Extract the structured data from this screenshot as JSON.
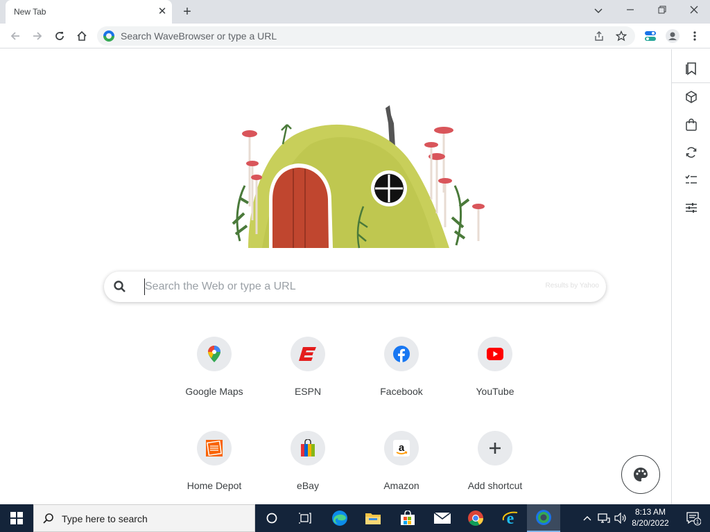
{
  "browser": {
    "tab_title": "New Tab",
    "omnibox_placeholder": "Search WaveBrowser or type a URL"
  },
  "newtab": {
    "search_placeholder": "Search the Web or type a URL",
    "results_by": "Results by Yahoo",
    "shortcuts": [
      {
        "label": "Google Maps",
        "icon": "google-maps-icon"
      },
      {
        "label": "ESPN",
        "icon": "espn-icon"
      },
      {
        "label": "Facebook",
        "icon": "facebook-icon"
      },
      {
        "label": "YouTube",
        "icon": "youtube-icon"
      },
      {
        "label": "Home Depot",
        "icon": "home-depot-icon"
      },
      {
        "label": "eBay",
        "icon": "ebay-icon"
      },
      {
        "label": "Amazon",
        "icon": "amazon-icon"
      },
      {
        "label": "Add shortcut",
        "icon": "add-icon"
      }
    ]
  },
  "taskbar": {
    "search_placeholder": "Type here to search",
    "time": "8:13 AM",
    "date": "8/20/2022",
    "notification_count": "1"
  },
  "colors": {
    "accent": "#1a73e8",
    "taskbar_bg": "#14243a",
    "tabstrip_bg": "#dee1e6"
  }
}
